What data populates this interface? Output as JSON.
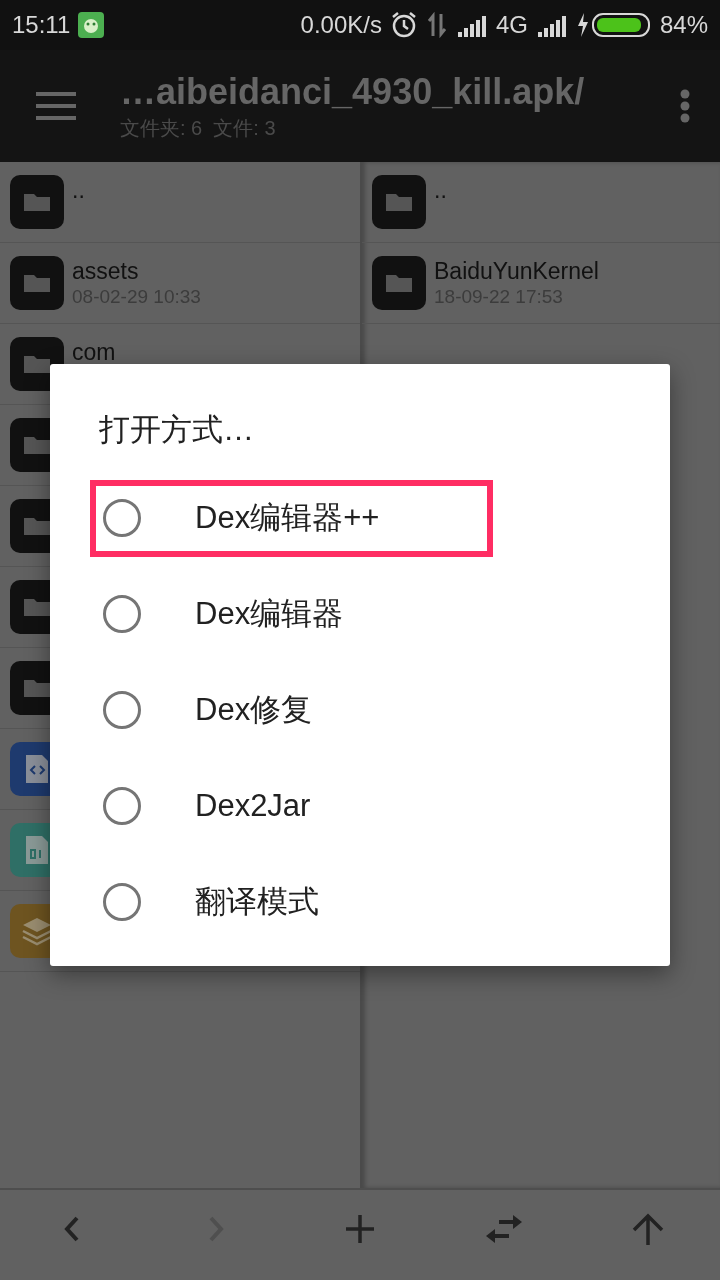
{
  "status_bar": {
    "time": "15:11",
    "net_speed": "0.00K/s",
    "network": "4G",
    "battery": "84%"
  },
  "header": {
    "title": "…aibeidanci_4930_kill.apk/",
    "subtitle": "文件夹: 6  文件: 3"
  },
  "left_pane": {
    "rows": [
      {
        "kind": "folder",
        "name": ".."
      },
      {
        "kind": "folder",
        "name": "assets",
        "date": "08-02-29 10:33"
      },
      {
        "kind": "folder",
        "name": "com"
      },
      {
        "kind": "folder"
      },
      {
        "kind": "folder"
      },
      {
        "kind": "folder"
      },
      {
        "kind": "folder"
      },
      {
        "kind": "code"
      },
      {
        "kind": "binary"
      },
      {
        "kind": "layers"
      }
    ]
  },
  "right_pane": {
    "rows": [
      {
        "kind": "folder",
        "name": ".."
      },
      {
        "kind": "folder",
        "name": "BaiduYunKernel",
        "date": "18-09-22 17:53"
      }
    ]
  },
  "dialog": {
    "title": "打开方式…",
    "options": [
      {
        "label": "Dex编辑器++",
        "selected": false,
        "highlighted": true
      },
      {
        "label": "Dex编辑器",
        "selected": false,
        "highlighted": false
      },
      {
        "label": "Dex修复",
        "selected": false,
        "highlighted": false
      },
      {
        "label": "Dex2Jar",
        "selected": false,
        "highlighted": false
      },
      {
        "label": "翻译模式",
        "selected": false,
        "highlighted": false
      }
    ]
  },
  "toolbar": {
    "buttons": [
      {
        "kind": "back",
        "disabled": false
      },
      {
        "kind": "forward",
        "disabled": true
      },
      {
        "kind": "add",
        "disabled": false
      },
      {
        "kind": "swap",
        "disabled": false
      },
      {
        "kind": "up",
        "disabled": false
      }
    ]
  }
}
